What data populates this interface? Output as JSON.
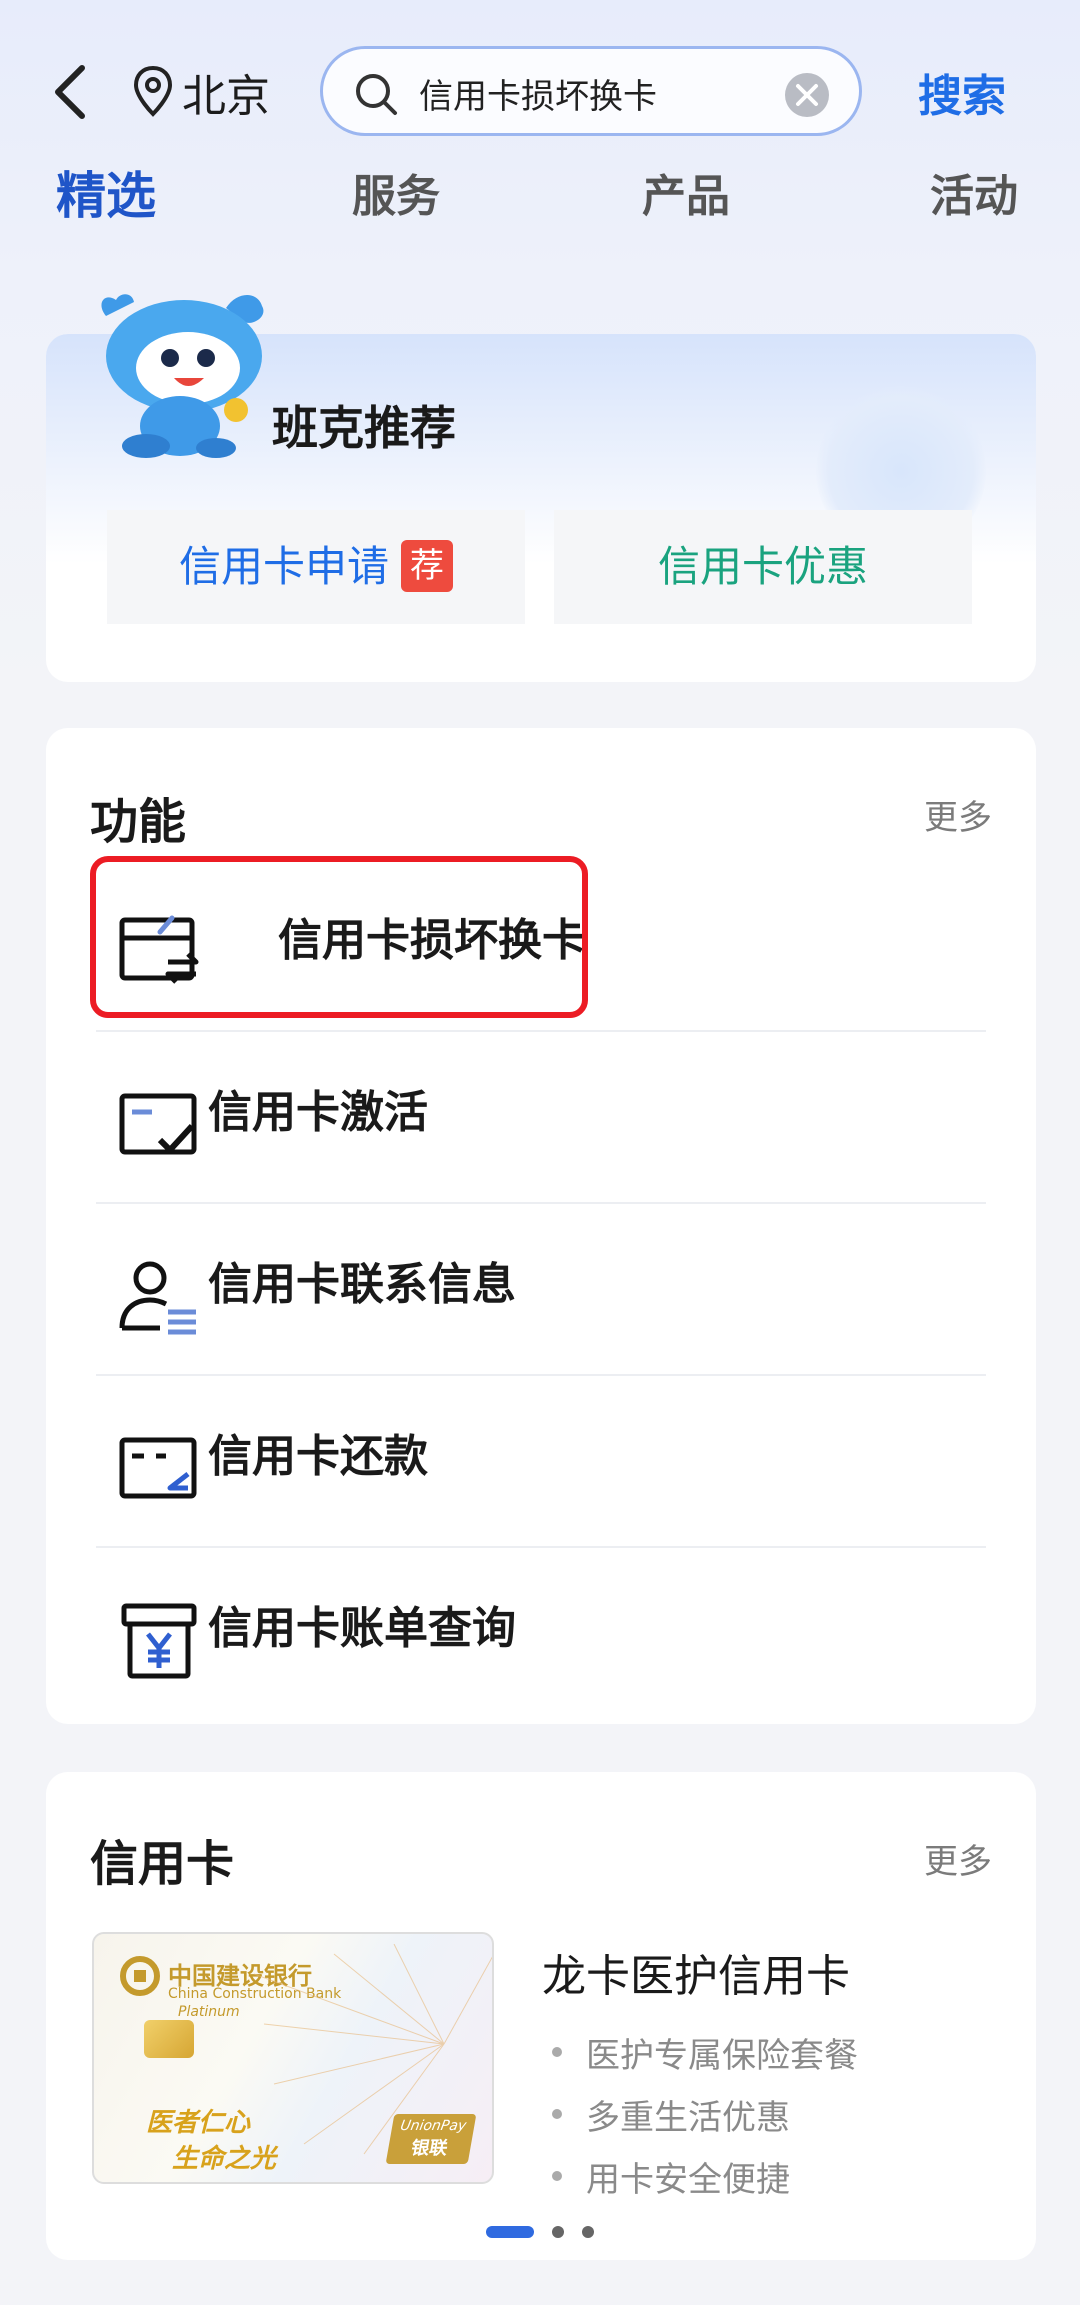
{
  "header": {
    "city": "北京",
    "search_value": "信用卡损坏换卡",
    "search_button": "搜索"
  },
  "tabs": [
    {
      "label": "精选",
      "active": true
    },
    {
      "label": "服务",
      "active": false
    },
    {
      "label": "产品",
      "active": false
    },
    {
      "label": "活动",
      "active": false
    }
  ],
  "recommend": {
    "title": "班克推荐",
    "buttons": [
      {
        "label": "信用卡申请",
        "badge": "荐",
        "color": "#1f6de6"
      },
      {
        "label": "信用卡优惠",
        "color": "#1aa37f"
      }
    ]
  },
  "functions": {
    "title": "功能",
    "more": "更多",
    "items": [
      {
        "label": "信用卡损坏换卡",
        "icon": "card-exchange-icon",
        "highlighted": true
      },
      {
        "label": "信用卡激活",
        "icon": "card-activate-icon"
      },
      {
        "label": "信用卡联系信息",
        "icon": "user-contact-icon"
      },
      {
        "label": "信用卡还款",
        "icon": "card-repay-icon"
      },
      {
        "label": "信用卡账单查询",
        "icon": "bill-yen-icon"
      }
    ]
  },
  "credit_cards": {
    "title": "信用卡",
    "more": "更多",
    "card_name": "龙卡医护信用卡",
    "features": [
      "医护专属保险套餐",
      "多重生活优惠",
      "用卡安全便捷"
    ],
    "card_image": {
      "bank_cn": "中国建设银行",
      "bank_en": "China Construction Bank",
      "tier": "Platinum",
      "slogan_1": "医者仁心",
      "slogan_2": "生命之光",
      "network": "UnionPay",
      "network_cn": "银联"
    },
    "pager": {
      "pages": 3,
      "active": 0
    }
  },
  "colors": {
    "accent": "#1f6de6",
    "tab_active": "#1f55c8",
    "highlight": "#ec1c24",
    "green": "#1aa37f"
  }
}
